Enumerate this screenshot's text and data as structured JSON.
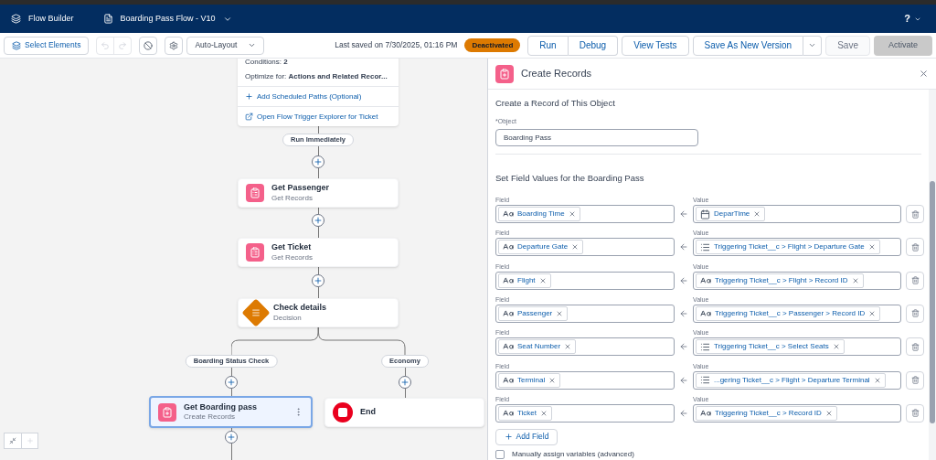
{
  "header": {
    "app_title": "Flow Builder",
    "flow_name": "Boarding Pass Flow - V10",
    "help": "?"
  },
  "toolbar": {
    "select_elements": "Select Elements",
    "undo_disabled": true,
    "redo_disabled": true,
    "layout": "Auto-Layout",
    "last_saved": "Last saved on 7/30/2025, 01:16 PM",
    "status": "Deactivated",
    "run": {
      "label": "Run",
      "disabled": false
    },
    "debug": {
      "label": "Debug",
      "disabled": false
    },
    "view_tests": {
      "label": "View Tests",
      "disabled": false
    },
    "save_as_new_version": {
      "label": "Save As New Version",
      "disabled": false
    },
    "save": {
      "label": "Save",
      "disabled": true
    },
    "activate": {
      "label": "Activate",
      "disabled": true
    }
  },
  "canvas": {
    "trigger": {
      "conditions": "Conditions: **2**",
      "optimize": "Optimize for: **Actions and Related Recor...**",
      "links": [
        {
          "label": "Add Scheduled Paths (Optional)",
          "kind": "add"
        },
        {
          "label": "Open Flow Trigger Explorer for Ticket",
          "kind": "external"
        }
      ]
    },
    "path_label": "Run Immediately",
    "nodes": [
      {
        "title": "Get Passenger",
        "subtitle": "Get Records",
        "kind": "get-records",
        "selected": false
      },
      {
        "title": "Get Ticket",
        "subtitle": "Get Records",
        "kind": "get-records",
        "selected": false
      },
      {
        "title": "Check details",
        "subtitle": "Decision",
        "kind": "decision",
        "selected": false
      }
    ],
    "branches": [
      {
        "label": "Boarding Status Check",
        "node": {
          "title": "Get Boarding pass",
          "subtitle": "Create Records",
          "kind": "create-records",
          "selected": true
        }
      },
      {
        "label": "Economy",
        "node": {
          "title": "End",
          "kind": "end",
          "selected": false
        }
      }
    ]
  },
  "panel": {
    "title": "Create Records",
    "section_title": "Create a Record of This Object",
    "object": {
      "label": "*Object",
      "value": "Boarding Pass"
    },
    "assignments_title": "Set Field Values for the Boarding Pass",
    "rows": [
      {
        "field_label": "Field",
        "field": {
          "text": "Boarding Time",
          "kind": "text"
        },
        "value_label": "Value",
        "value": {
          "text": "DeparTime",
          "kind": "datetime"
        }
      },
      {
        "field_label": "Field",
        "field": {
          "text": "Departure Gate",
          "kind": "text"
        },
        "value_label": "Value",
        "value": {
          "text": "Triggering Ticket__c > Flight > Departure Gate",
          "kind": "picklist"
        }
      },
      {
        "field_label": "Field",
        "field": {
          "text": "Flight",
          "kind": "text"
        },
        "value_label": "Value",
        "value": {
          "text": "Triggering Ticket__c > Flight > Record ID",
          "kind": "text"
        }
      },
      {
        "field_label": "Field",
        "field": {
          "text": "Passenger",
          "kind": "text"
        },
        "value_label": "Value",
        "value": {
          "text": "Triggering Ticket__c > Passenger > Record ID",
          "kind": "text"
        }
      },
      {
        "field_label": "Field",
        "field": {
          "text": "Seat Number",
          "kind": "text"
        },
        "value_label": "Value",
        "value": {
          "text": "Triggering Ticket__c > Select Seats",
          "kind": "picklist"
        }
      },
      {
        "field_label": "Field",
        "field": {
          "text": "Terminal",
          "kind": "text"
        },
        "value_label": "Value",
        "value": {
          "text": "...gering Ticket__c > Flight > Departure Terminal",
          "kind": "picklist"
        }
      },
      {
        "field_label": "Field",
        "field": {
          "text": "Ticket",
          "kind": "text"
        },
        "value_label": "Value",
        "value": {
          "text": "Triggering Ticket__c > Record ID",
          "kind": "text"
        }
      }
    ],
    "add_field": "Add Field",
    "manual_checkbox": {
      "label": "Manually assign variables (advanced)",
      "checked": false
    }
  }
}
